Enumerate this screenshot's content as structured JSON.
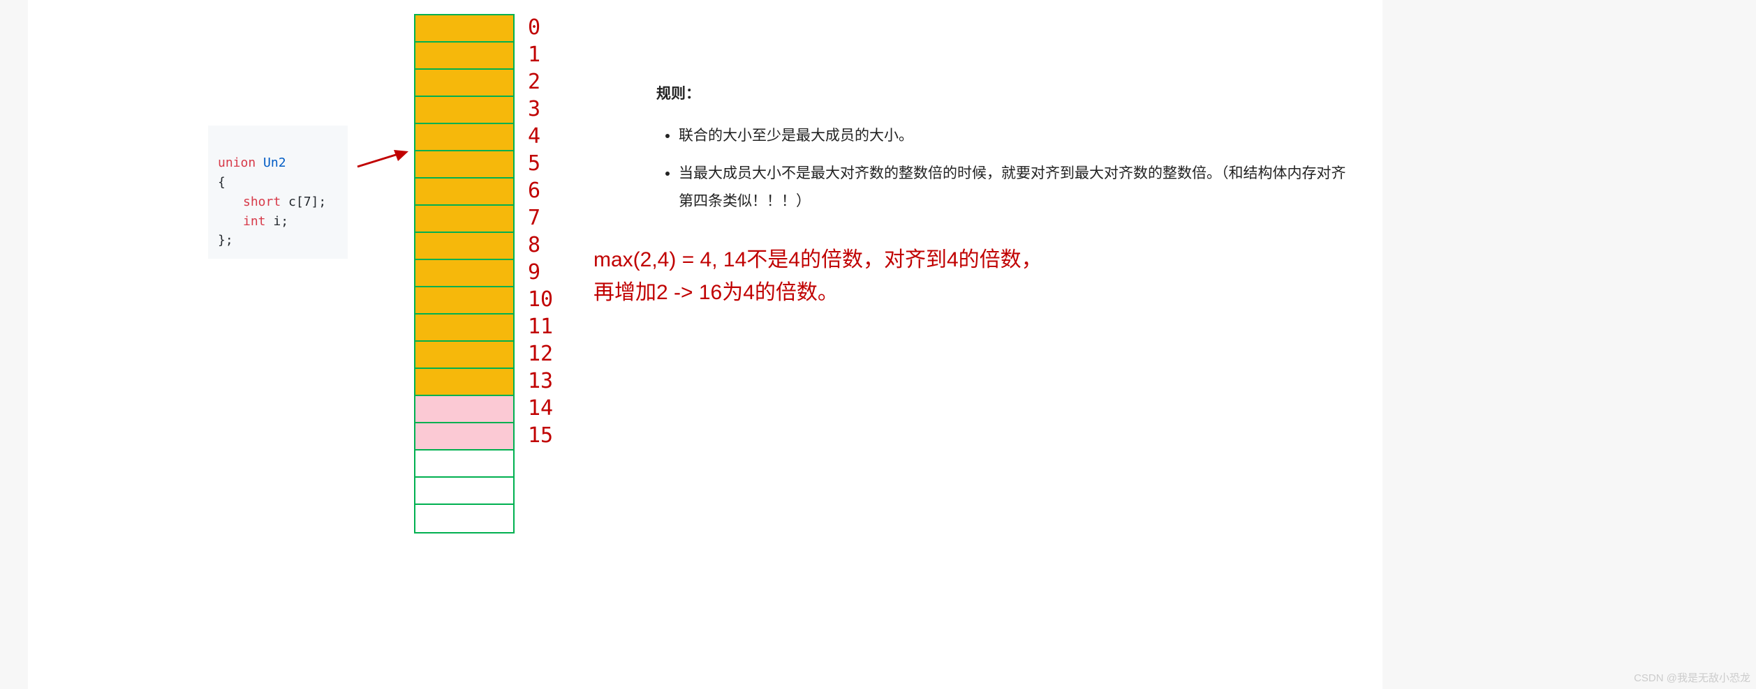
{
  "code": {
    "kw_union": "union",
    "name": "Un2",
    "open": "{",
    "member1_type": "short",
    "member1_rest": " c[7];",
    "member2_type": "int",
    "member2_rest": " i;",
    "close": "};"
  },
  "memory": {
    "cells": [
      {
        "idx": "0",
        "color": "yellow"
      },
      {
        "idx": "1",
        "color": "yellow"
      },
      {
        "idx": "2",
        "color": "yellow"
      },
      {
        "idx": "3",
        "color": "yellow"
      },
      {
        "idx": "4",
        "color": "yellow"
      },
      {
        "idx": "5",
        "color": "yellow"
      },
      {
        "idx": "6",
        "color": "yellow"
      },
      {
        "idx": "7",
        "color": "yellow"
      },
      {
        "idx": "8",
        "color": "yellow"
      },
      {
        "idx": "9",
        "color": "yellow"
      },
      {
        "idx": "10",
        "color": "yellow"
      },
      {
        "idx": "11",
        "color": "yellow"
      },
      {
        "idx": "12",
        "color": "yellow"
      },
      {
        "idx": "13",
        "color": "yellow"
      },
      {
        "idx": "14",
        "color": "pink"
      },
      {
        "idx": "15",
        "color": "pink"
      },
      {
        "idx": "",
        "color": "white"
      },
      {
        "idx": "",
        "color": "white"
      },
      {
        "idx": "",
        "color": "white"
      }
    ]
  },
  "rules": {
    "title": "规则：",
    "item1": "联合的大小至少是最大成员的大小。",
    "item2": "当最大成员大小不是最大对齐数的整数倍的时候，就要对齐到最大对齐数的整数倍。（和结构体内存对齐第四条类似！！！）"
  },
  "red_note": {
    "line1": "max(2,4) = 4, 14不是4的倍数，对齐到4的倍数，",
    "line2": "再增加2 -> 16为4的倍数。"
  },
  "watermark": "CSDN @我是无敌小恐龙"
}
